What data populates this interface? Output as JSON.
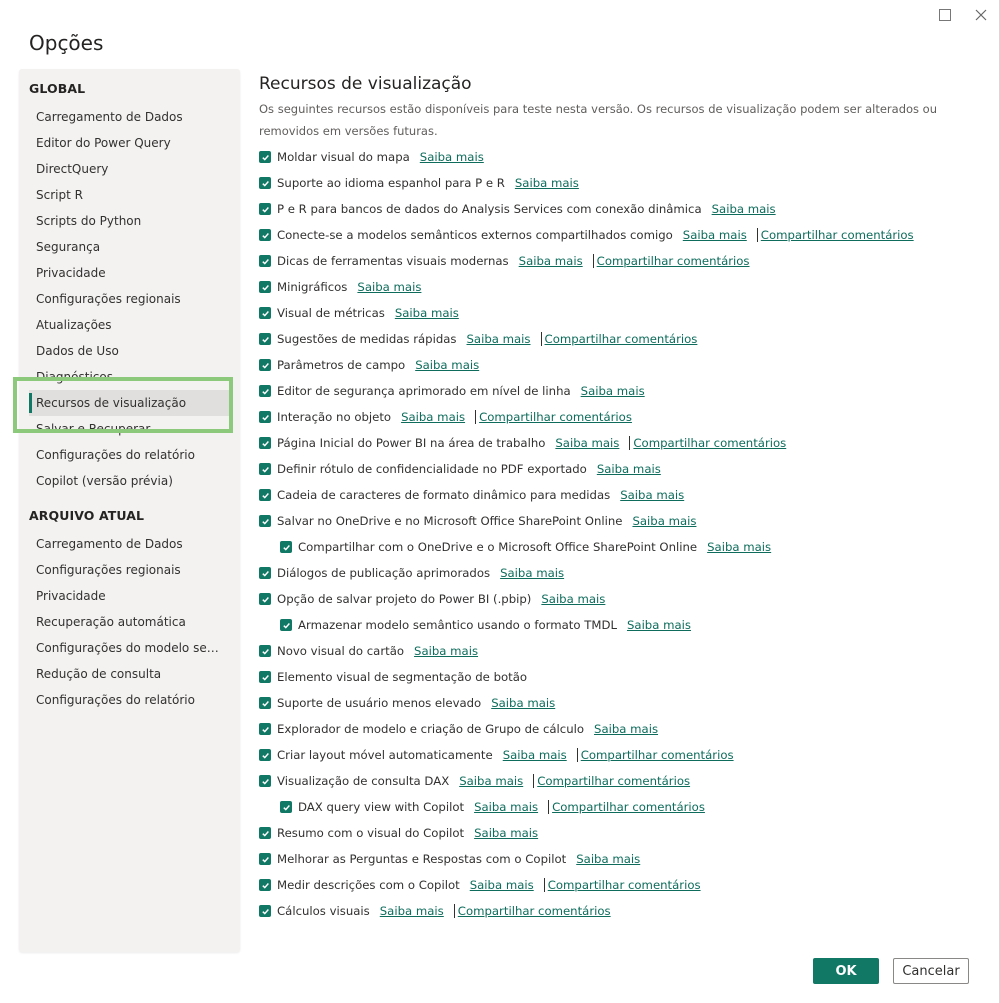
{
  "window": {
    "maximize_icon": "maximize-icon",
    "close_icon": "close-icon"
  },
  "dialog": {
    "title": "Opções"
  },
  "sidebar": {
    "global": {
      "heading": "GLOBAL",
      "items": [
        {
          "label": "Carregamento de Dados"
        },
        {
          "label": "Editor do Power Query"
        },
        {
          "label": "DirectQuery"
        },
        {
          "label": "Script R"
        },
        {
          "label": "Scripts do Python"
        },
        {
          "label": "Segurança"
        },
        {
          "label": "Privacidade"
        },
        {
          "label": "Configurações regionais"
        },
        {
          "label": "Atualizações"
        },
        {
          "label": "Dados de Uso"
        },
        {
          "label": "Diagnósticos"
        },
        {
          "label": "Recursos de visualização",
          "active": true
        },
        {
          "label": "Salvar e Recuperar"
        },
        {
          "label": "Configurações do relatório"
        },
        {
          "label": "Copilot (versão prévia)"
        }
      ]
    },
    "current_file": {
      "heading": "ARQUIVO ATUAL",
      "items": [
        {
          "label": "Carregamento de Dados"
        },
        {
          "label": "Configurações regionais"
        },
        {
          "label": "Privacidade"
        },
        {
          "label": "Recuperação automática"
        },
        {
          "label": "Configurações do modelo semân..."
        },
        {
          "label": "Redução de consulta"
        },
        {
          "label": "Configurações do relatório"
        }
      ]
    },
    "highlight_color": "#8dc97a",
    "accent_color": "#117865"
  },
  "content": {
    "title": "Recursos de visualização",
    "description": "Os seguintes recursos estão disponíveis para teste nesta versão. Os recursos de visualização podem ser alterados ou removidos em versões futuras.",
    "learn_more_label": "Saiba mais",
    "share_feedback_label": "Compartilhar comentários",
    "features": [
      {
        "label": "Moldar visual do mapa",
        "checked": true,
        "learn_more": true,
        "feedback": false,
        "indent": false
      },
      {
        "label": "Suporte ao idioma espanhol para P e R",
        "checked": true,
        "learn_more": true,
        "feedback": false,
        "indent": false
      },
      {
        "label": "P e R para bancos de dados do Analysis Services com conexão dinâmica",
        "checked": true,
        "learn_more": true,
        "feedback": false,
        "indent": false
      },
      {
        "label": "Conecte-se a modelos semânticos externos compartilhados comigo",
        "checked": true,
        "learn_more": true,
        "feedback": true,
        "indent": false
      },
      {
        "label": "Dicas de ferramentas visuais modernas",
        "checked": true,
        "learn_more": true,
        "feedback": true,
        "indent": false
      },
      {
        "label": "Minigráficos",
        "checked": true,
        "learn_more": true,
        "feedback": false,
        "indent": false
      },
      {
        "label": "Visual de métricas",
        "checked": true,
        "learn_more": true,
        "feedback": false,
        "indent": false
      },
      {
        "label": "Sugestões de medidas rápidas",
        "checked": true,
        "learn_more": true,
        "feedback": true,
        "indent": false
      },
      {
        "label": "Parâmetros de campo",
        "checked": true,
        "learn_more": true,
        "feedback": false,
        "indent": false
      },
      {
        "label": "Editor de segurança aprimorado em nível de linha",
        "checked": true,
        "learn_more": true,
        "feedback": false,
        "indent": false
      },
      {
        "label": "Interação no objeto",
        "checked": true,
        "learn_more": true,
        "feedback": true,
        "indent": false
      },
      {
        "label": "Página Inicial do Power BI na área de trabalho",
        "checked": true,
        "learn_more": true,
        "feedback": true,
        "indent": false
      },
      {
        "label": "Definir rótulo de confidencialidade no PDF exportado",
        "checked": true,
        "learn_more": true,
        "feedback": false,
        "indent": false
      },
      {
        "label": "Cadeia de caracteres de formato dinâmico para medidas",
        "checked": true,
        "learn_more": true,
        "feedback": false,
        "indent": false
      },
      {
        "label": "Salvar no OneDrive e no Microsoft Office SharePoint Online",
        "checked": true,
        "learn_more": true,
        "feedback": false,
        "indent": false
      },
      {
        "label": "Compartilhar com o OneDrive e o Microsoft Office SharePoint Online",
        "checked": true,
        "learn_more": true,
        "feedback": false,
        "indent": true
      },
      {
        "label": "Diálogos de publicação aprimorados",
        "checked": true,
        "learn_more": true,
        "feedback": false,
        "indent": false
      },
      {
        "label": "Opção de salvar projeto do Power BI (.pbip)",
        "checked": true,
        "learn_more": true,
        "feedback": false,
        "indent": false
      },
      {
        "label": "Armazenar modelo semântico usando o formato TMDL",
        "checked": true,
        "learn_more": true,
        "feedback": false,
        "indent": true
      },
      {
        "label": "Novo visual do cartão",
        "checked": true,
        "learn_more": true,
        "feedback": false,
        "indent": false
      },
      {
        "label": "Elemento visual de segmentação de botão",
        "checked": true,
        "learn_more": false,
        "feedback": false,
        "indent": false
      },
      {
        "label": "Suporte de usuário menos elevado",
        "checked": true,
        "learn_more": true,
        "feedback": false,
        "indent": false
      },
      {
        "label": "Explorador de modelo e criação de Grupo de cálculo",
        "checked": true,
        "learn_more": true,
        "feedback": false,
        "indent": false
      },
      {
        "label": "Criar layout móvel automaticamente",
        "checked": true,
        "learn_more": true,
        "feedback": true,
        "indent": false
      },
      {
        "label": "Visualização de consulta DAX",
        "checked": true,
        "learn_more": true,
        "feedback": true,
        "indent": false
      },
      {
        "label": "DAX query view with Copilot",
        "checked": true,
        "learn_more": true,
        "feedback": true,
        "indent": true
      },
      {
        "label": "Resumo com o visual do Copilot",
        "checked": true,
        "learn_more": true,
        "feedback": false,
        "indent": false
      },
      {
        "label": "Melhorar as Perguntas e Respostas com o Copilot",
        "checked": true,
        "learn_more": true,
        "feedback": false,
        "indent": false
      },
      {
        "label": "Medir descrições com o Copilot",
        "checked": true,
        "learn_more": true,
        "feedback": true,
        "indent": false
      },
      {
        "label": "Cálculos visuais",
        "checked": true,
        "learn_more": true,
        "feedback": true,
        "indent": false
      }
    ]
  },
  "footer": {
    "ok_label": "OK",
    "cancel_label": "Cancelar"
  }
}
